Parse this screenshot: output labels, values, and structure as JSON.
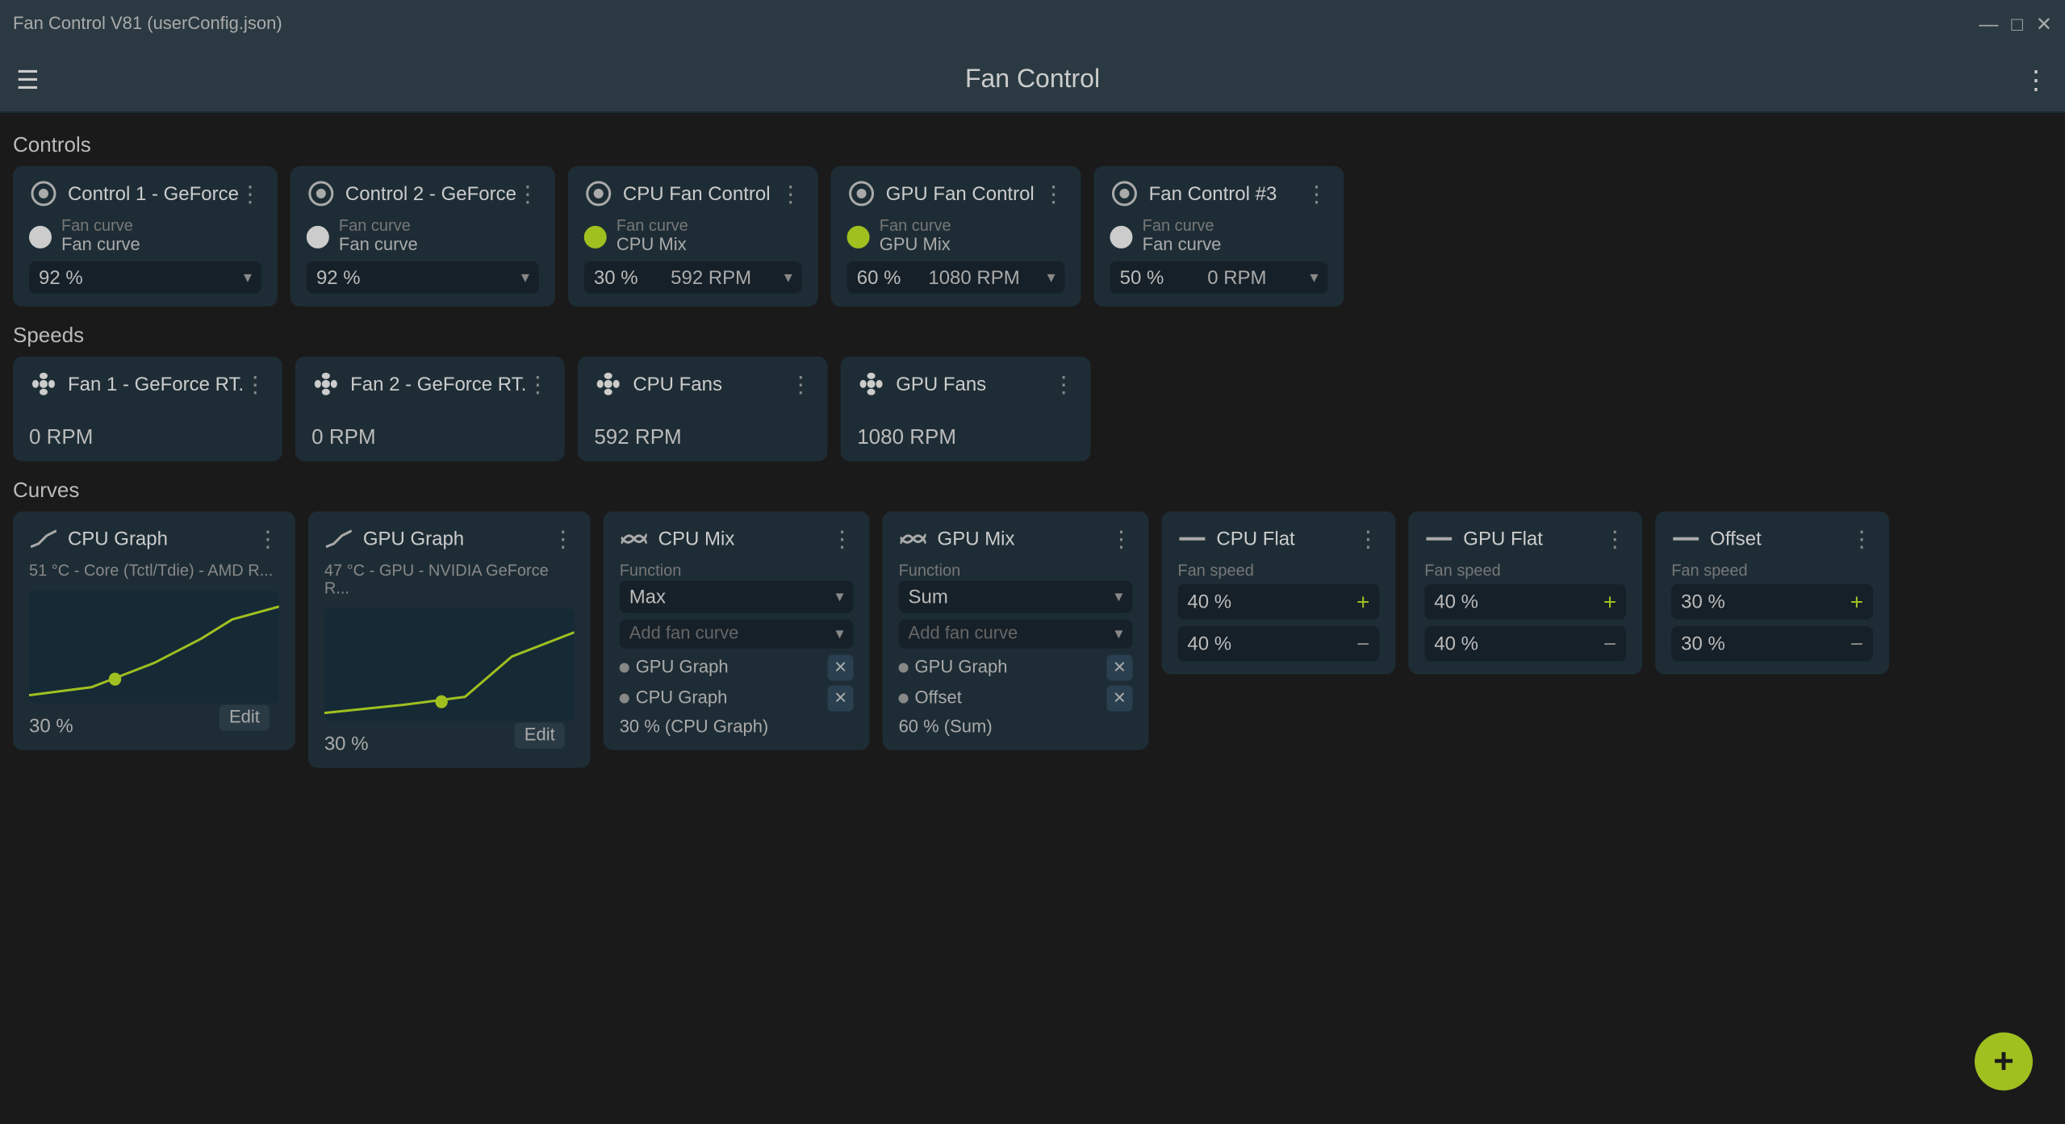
{
  "window": {
    "title": "Fan Control V81 (userConfig.json)",
    "controls": [
      "—",
      "□",
      "✕"
    ]
  },
  "header": {
    "title": "Fan Control",
    "menu_icon": "☰",
    "more_icon": "⋮"
  },
  "sections": {
    "controls_label": "Controls",
    "speeds_label": "Speeds",
    "curves_label": "Curves"
  },
  "controls": [
    {
      "id": "control1",
      "title": "Control 1 - GeForce",
      "fan_curve_label": "Fan curve",
      "fan_curve_value": "Fan curve",
      "toggle_state": "white",
      "percent": "92 %",
      "rpm": "",
      "has_rpm": false
    },
    {
      "id": "control2",
      "title": "Control 2 - GeForce",
      "fan_curve_label": "Fan curve",
      "fan_curve_value": "Fan curve",
      "toggle_state": "white",
      "percent": "92 %",
      "rpm": "",
      "has_rpm": false
    },
    {
      "id": "cpu-fan-control",
      "title": "CPU Fan Control",
      "fan_curve_label": "Fan curve",
      "fan_curve_value": "CPU Mix",
      "toggle_state": "green",
      "percent": "30 %",
      "rpm": "592 RPM",
      "has_rpm": true
    },
    {
      "id": "gpu-fan-control",
      "title": "GPU Fan Control",
      "fan_curve_label": "Fan curve",
      "fan_curve_value": "GPU Mix",
      "toggle_state": "green",
      "percent": "60 %",
      "rpm": "1080 RPM",
      "has_rpm": true
    },
    {
      "id": "fan-control-3",
      "title": "Fan Control #3",
      "fan_curve_label": "Fan curve",
      "fan_curve_value": "Fan curve",
      "toggle_state": "white",
      "percent": "50 %",
      "rpm": "0 RPM",
      "has_rpm": true
    }
  ],
  "speeds": [
    {
      "id": "fan1",
      "title": "Fan 1 - GeForce RT.",
      "rpm": "0 RPM"
    },
    {
      "id": "fan2",
      "title": "Fan 2 - GeForce RT.",
      "rpm": "0 RPM"
    },
    {
      "id": "cpu-fans",
      "title": "CPU Fans",
      "rpm": "592 RPM"
    },
    {
      "id": "gpu-fans",
      "title": "GPU Fans",
      "rpm": "1080 RPM"
    }
  ],
  "curves": [
    {
      "id": "cpu-graph",
      "title": "CPU Graph",
      "subtitle": "51 °C - Core (Tctl/Tdie) - AMD R...",
      "pct": "30 %",
      "type": "graph",
      "has_edit": true
    },
    {
      "id": "gpu-graph",
      "title": "GPU Graph",
      "subtitle": "47 °C - GPU - NVIDIA GeForce R...",
      "pct": "30 %",
      "type": "graph",
      "has_edit": true
    },
    {
      "id": "cpu-mix",
      "title": "CPU Mix",
      "function_label": "Function",
      "function_value": "Max",
      "add_label": "Add fan curve",
      "tags": [
        "GPU Graph",
        "CPU Graph"
      ],
      "summary": "30 % (CPU Graph)",
      "type": "mix"
    },
    {
      "id": "gpu-mix",
      "title": "GPU Mix",
      "function_label": "Function",
      "function_value": "Sum",
      "add_label": "Add fan curve",
      "tags": [
        "GPU Graph",
        "Offset"
      ],
      "summary": "60 % (Sum)",
      "type": "mix"
    },
    {
      "id": "cpu-flat",
      "title": "CPU Flat",
      "fan_speed_label": "Fan speed",
      "fan_speed_value": "40 %",
      "type": "flat"
    },
    {
      "id": "gpu-flat",
      "title": "GPU Flat",
      "fan_speed_label": "Fan speed",
      "fan_speed_value": "40 %",
      "type": "flat"
    },
    {
      "id": "offset",
      "title": "Offset",
      "fan_speed_label": "Fan speed",
      "fan_speed_value": "30 %",
      "type": "flat",
      "is_offset": true
    }
  ],
  "fab": {
    "label": "+"
  }
}
